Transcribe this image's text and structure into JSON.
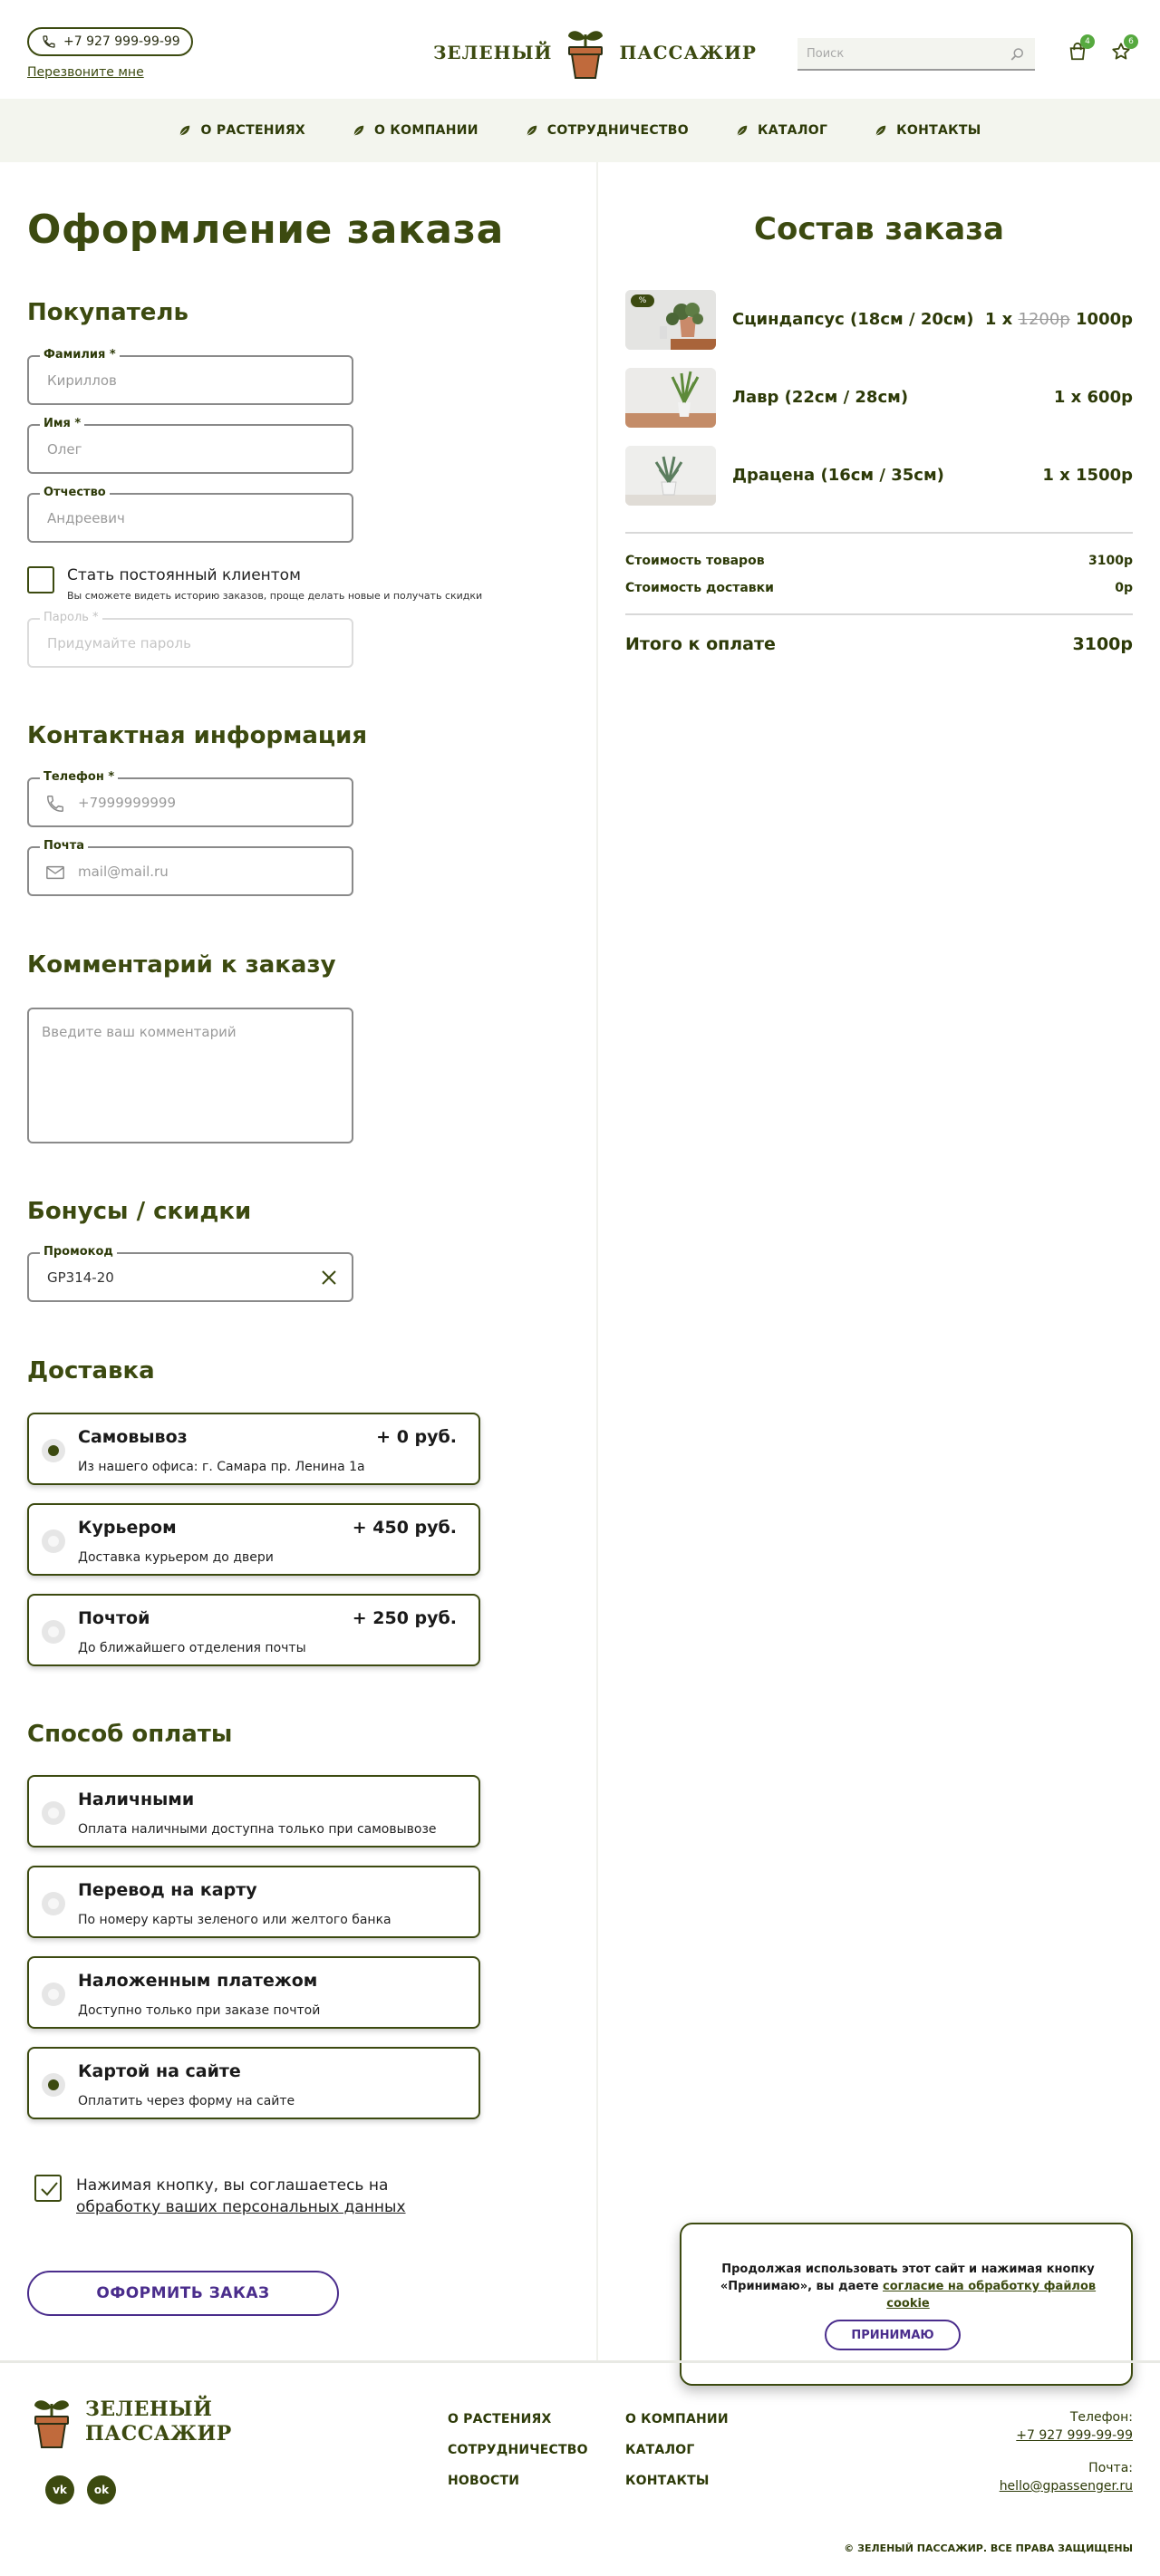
{
  "header": {
    "phone": "+7 927 999-99-99",
    "callback_link": "Перезвоните мне",
    "logo_left": "ЗЕЛЕНЫЙ",
    "logo_right": "ПАССАЖИР",
    "search_placeholder": "Поиск",
    "cart_count": "4",
    "favorites_count": "6"
  },
  "nav": {
    "items": [
      {
        "label": "О РАСТЕНИЯХ"
      },
      {
        "label": "О КОМПАНИИ"
      },
      {
        "label": "СОТРУДНИЧЕСТВО"
      },
      {
        "label": "КАТАЛОГ"
      },
      {
        "label": "КОНТАКТЫ"
      }
    ]
  },
  "checkout": {
    "title": "Оформление заказа",
    "buyer": {
      "heading": "Покупатель",
      "last_name": {
        "label": "Фамилия *",
        "placeholder": "Кириллов"
      },
      "first_name": {
        "label": "Имя *",
        "placeholder": "Олег"
      },
      "patronymic": {
        "label": "Отчество",
        "placeholder": "Андреевич"
      },
      "regular_client": {
        "label": "Стать постоянный клиентом",
        "hint": "Вы сможете видеть историю заказов, проще делать новые и получать скидки"
      },
      "password": {
        "label": "Пароль *",
        "placeholder": "Придумайте пароль"
      }
    },
    "contacts": {
      "heading": "Контактная информация",
      "phone": {
        "label": "Телефон *",
        "placeholder": "+7999999999"
      },
      "email": {
        "label": "Почта",
        "placeholder": "mail@mail.ru"
      }
    },
    "comment": {
      "heading": "Комментарий к заказу",
      "placeholder": "Введите ваш комментарий"
    },
    "bonus": {
      "heading": "Бонусы / скидки",
      "promo_label": "Промокод",
      "promo_value": "GP314-20"
    },
    "delivery": {
      "heading": "Доставка",
      "options": [
        {
          "title": "Самовывоз",
          "price": "+ 0 руб.",
          "desc": "Из нашего офиса: г. Самара пр. Ленина 1а",
          "selected": true
        },
        {
          "title": "Курьером",
          "price": "+ 450 руб.",
          "desc": "Доставка курьером до двери",
          "selected": false
        },
        {
          "title": "Почтой",
          "price": "+ 250 руб.",
          "desc": "До ближайшего отделения почты",
          "selected": false
        }
      ]
    },
    "payment": {
      "heading": "Способ оплаты",
      "options": [
        {
          "title": "Наличными",
          "desc": "Оплата наличными доступна только при самовывозе",
          "selected": false
        },
        {
          "title": "Перевод на карту",
          "desc": "По номеру карты зеленого или желтого банка",
          "selected": false
        },
        {
          "title": "Наложенным платежом",
          "desc": "Доступно только при заказе почтой",
          "selected": false
        },
        {
          "title": "Картой на сайте",
          "desc": "Оплатить через форму на сайте",
          "selected": true
        }
      ]
    },
    "agreement": {
      "text": "Нажимая кнопку, вы соглашаетесь на ",
      "link": "обработку ваших персональных данных"
    },
    "submit_label": "ОФОРМИТЬ ЗАКАЗ"
  },
  "order": {
    "title": "Состав заказа",
    "items": [
      {
        "name": "Сциндапсус (18см / 20см)",
        "qty": "1 x ",
        "old_price": "1200р",
        "price": "1000р",
        "badge": "%"
      },
      {
        "name": "Лавр (22см / 28см)",
        "qty": "1 x ",
        "old_price": "",
        "price": "600р",
        "badge": ""
      },
      {
        "name": "Драцена  (16см / 35см)",
        "qty": "1 x ",
        "old_price": "",
        "price": "1500р",
        "badge": ""
      }
    ],
    "goods_cost_label": "Стоимость товаров",
    "goods_cost": "3100р",
    "delivery_cost_label": "Стоимость доставки",
    "delivery_cost": "0р",
    "total_label": "Итого к оплате",
    "total": "3100р"
  },
  "cookie": {
    "text_1": "Продолжая использовать этот сайт и нажимая кнопку «Принимаю», вы даете ",
    "link": "согласие на обработку файлов cookie",
    "button": "ПРИНИМАЮ"
  },
  "footer": {
    "logo_line1": "ЗЕЛЕНЫЙ",
    "logo_line2": "ПАССАЖИР",
    "links": [
      "О РАСТЕНИЯХ",
      "О КОМПАНИИ",
      "СОТРУДНИЧЕСТВО",
      "КАТАЛОГ",
      "НОВОСТИ",
      "КОНТАКТЫ"
    ],
    "phone_label": "Телефон:",
    "phone": "+7 927 999-99-99",
    "email_label": "Почта:",
    "email": "hello@gpassenger.ru",
    "copyright": "© ЗЕЛЕНЫЙ ПАССАЖИР. ВСЕ ПРАВА ЗАЩИЩЕНЫ",
    "social": [
      "vk",
      "ok"
    ]
  },
  "colors": {
    "brand_green": "#3c4a10",
    "accent_purple": "#4a2d8c",
    "badge_green": "#56a93f",
    "nav_bg": "#f3f5ee"
  }
}
